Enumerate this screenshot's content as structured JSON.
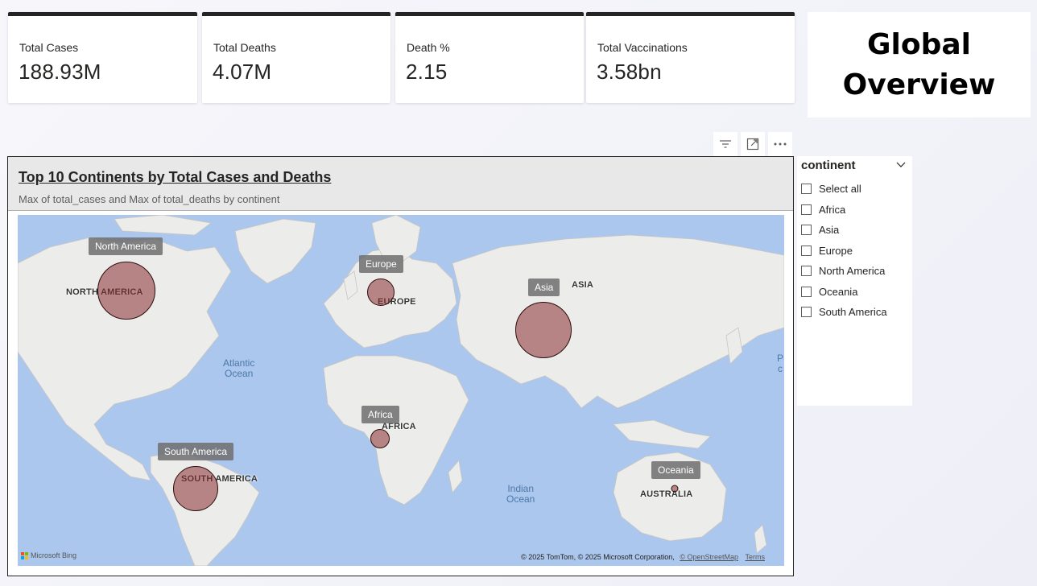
{
  "cards": [
    {
      "label": "Total Cases",
      "value": "188.93M"
    },
    {
      "label": "Total Deaths",
      "value": "4.07M"
    },
    {
      "label": "Death %",
      "value": "2.15"
    },
    {
      "label": "Total Vaccinations",
      "value": "3.58bn"
    }
  ],
  "page_title": "Global Overview",
  "visual": {
    "title": "Top 10 Continents by Total Cases and Deaths",
    "subtitle": "Max of total_cases and Max of total_deaths by continent",
    "bubble_color": "#8b3030"
  },
  "map": {
    "region_labels": {
      "north_america": "NORTH AMERICA",
      "europe": "EUROPE",
      "asia": "ASIA",
      "africa": "AFRICA",
      "south_america": "SOUTH AMERICA",
      "australia": "AUSTRALIA"
    },
    "oceans": {
      "atlantic": "Atlantic\nOcean",
      "indian": "Indian\nOcean",
      "pacific_partial": "P\nc"
    },
    "tooltips": {
      "north_america": "North America",
      "europe": "Europe",
      "asia": "Asia",
      "africa": "Africa",
      "south_america": "South America",
      "oceania": "Oceania"
    },
    "attribution": "© 2025 TomTom, © 2025 Microsoft Corporation,",
    "osm_link": "© OpenStreetMap",
    "terms_link": "Terms",
    "bing_label": "Microsoft Bing"
  },
  "slicer": {
    "header": "continent",
    "items": [
      "Select all",
      "Africa",
      "Asia",
      "Europe",
      "North America",
      "Oceania",
      "South America"
    ]
  },
  "toolbar": {
    "icons": [
      "filter-icon",
      "focus-mode-icon",
      "more-options-icon"
    ]
  }
}
